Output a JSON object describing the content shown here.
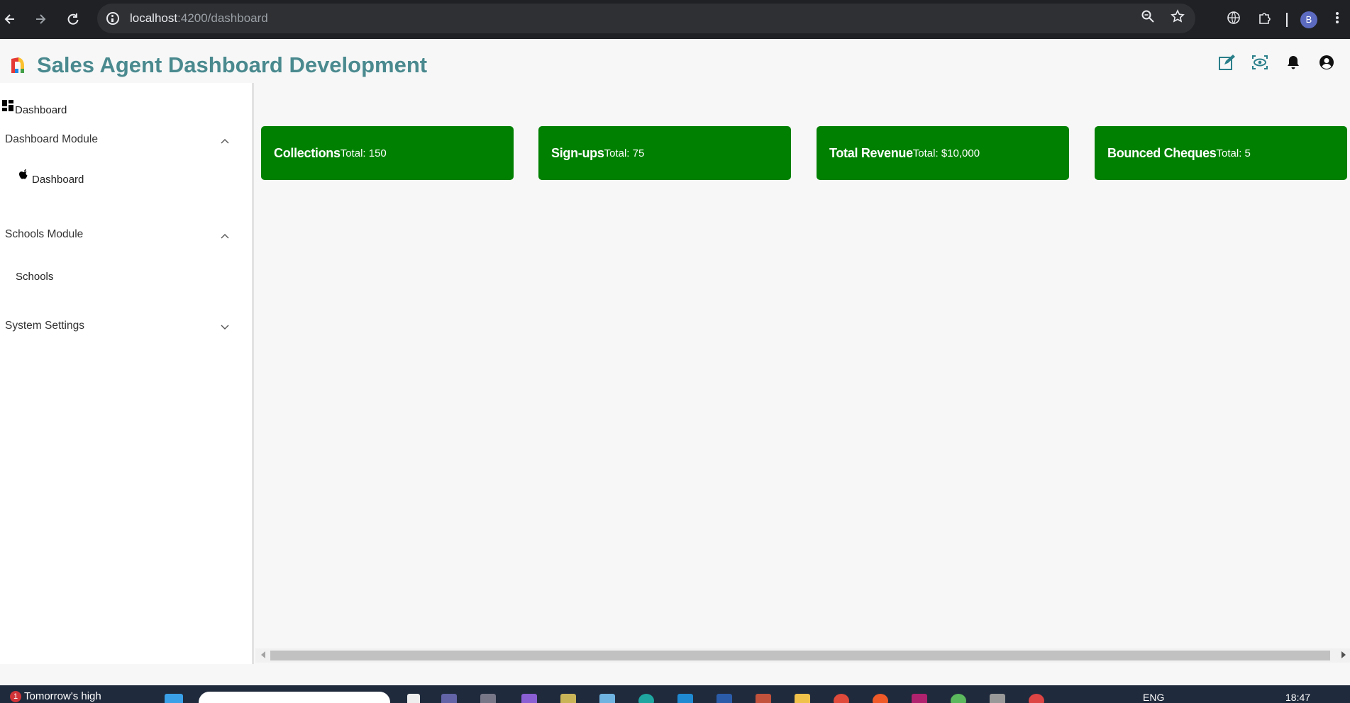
{
  "browser": {
    "url_host": "localhost",
    "url_path": ":4200/dashboard",
    "profile_initial": "B"
  },
  "header": {
    "title": "Sales Agent Dashboard Development"
  },
  "sidebar": {
    "top_link": "Dashboard",
    "groups": [
      {
        "label": "Dashboard Module",
        "expanded": true,
        "items": [
          "Dashboard"
        ]
      },
      {
        "label": "Schools Module",
        "expanded": true,
        "items": [
          "Schools"
        ]
      },
      {
        "label": "System Settings",
        "expanded": false,
        "items": []
      }
    ]
  },
  "cards": [
    {
      "title": "Collections",
      "value": "Total: 150"
    },
    {
      "title": "Sign-ups",
      "value": "Total: 75"
    },
    {
      "title": "Total Revenue",
      "value": "Total: $10,000"
    },
    {
      "title": "Bounced Cheques",
      "value": "Total: 5"
    }
  ],
  "taskbar": {
    "weather_text": "Tomorrow's high",
    "weather_badge": "1",
    "language": "ENG",
    "time": "18:47"
  },
  "colors": {
    "card_bg": "#008000",
    "title_color": "#4a8a8f",
    "chrome_bg": "#202124"
  }
}
